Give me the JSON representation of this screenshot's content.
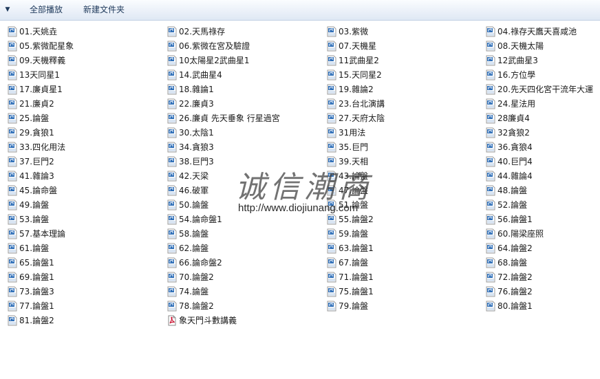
{
  "toolbar": {
    "menu_arrow": "▼",
    "play_all_label": "全部播放",
    "new_folder_label": "新建文件夹"
  },
  "watermark": {
    "text": "诚信潮商",
    "url": "http://www.diojiunang.com"
  },
  "files": [
    {
      "name": "01.天姚垚",
      "type": "mp3"
    },
    {
      "name": "02.天馬祿存",
      "type": "mp3"
    },
    {
      "name": "03.紫微",
      "type": "mp3"
    },
    {
      "name": "04.祿存天鷹天喜咸池",
      "type": "mp3"
    },
    {
      "name": "05.紫微配星象",
      "type": "mp3"
    },
    {
      "name": "06.紫微在宮及驗證",
      "type": "mp3"
    },
    {
      "name": "07.天機星",
      "type": "mp3"
    },
    {
      "name": "08.天機太陽",
      "type": "mp3"
    },
    {
      "name": "09.天機釋義",
      "type": "mp3"
    },
    {
      "name": "10太陽星2武曲星1",
      "type": "mp3"
    },
    {
      "name": "11武曲星2",
      "type": "mp3"
    },
    {
      "name": "12武曲星3",
      "type": "mp3"
    },
    {
      "name": "13天同星1",
      "type": "mp3"
    },
    {
      "name": "14.武曲星4",
      "type": "mp3"
    },
    {
      "name": "15.天同星2",
      "type": "mp3"
    },
    {
      "name": "16.方位學",
      "type": "mp3"
    },
    {
      "name": "17.廉貞星1",
      "type": "mp3"
    },
    {
      "name": "18.雜論1",
      "type": "mp3"
    },
    {
      "name": "19.雜論2",
      "type": "mp3"
    },
    {
      "name": "20.先天四化宮干流年大運",
      "type": "mp3"
    },
    {
      "name": "21.廉貞2",
      "type": "mp3"
    },
    {
      "name": "22.廉貞3",
      "type": "mp3"
    },
    {
      "name": "23.台北演講",
      "type": "mp3"
    },
    {
      "name": "24.星法用",
      "type": "mp3"
    },
    {
      "name": "25.論盤",
      "type": "mp3"
    },
    {
      "name": "26.廉貞 先天垂象 行星過宮",
      "type": "mp3"
    },
    {
      "name": "27.天府太陰",
      "type": "mp3"
    },
    {
      "name": "28廉貞4",
      "type": "mp3"
    },
    {
      "name": "29.貪狼1",
      "type": "mp3"
    },
    {
      "name": "30.太陰1",
      "type": "mp3"
    },
    {
      "name": "31用法",
      "type": "mp3"
    },
    {
      "name": "32貪狼2",
      "type": "mp3"
    },
    {
      "name": "33.四化用法",
      "type": "mp3"
    },
    {
      "name": "34.貪狼3",
      "type": "mp3"
    },
    {
      "name": "35.巨門",
      "type": "mp3"
    },
    {
      "name": "36.貪狼4",
      "type": "mp3"
    },
    {
      "name": "37.巨門2",
      "type": "mp3"
    },
    {
      "name": "38.巨門3",
      "type": "mp3"
    },
    {
      "name": "39.天相",
      "type": "mp3"
    },
    {
      "name": "40.巨門4",
      "type": "mp3"
    },
    {
      "name": "41.雜論3",
      "type": "mp3"
    },
    {
      "name": "42.天梁",
      "type": "mp3"
    },
    {
      "name": "43.論盤",
      "type": "mp3"
    },
    {
      "name": "44.雜論4",
      "type": "mp3"
    },
    {
      "name": "45.論命盤",
      "type": "mp3"
    },
    {
      "name": "46.破軍",
      "type": "mp3"
    },
    {
      "name": "47.論盤",
      "type": "mp3"
    },
    {
      "name": "48.論盤",
      "type": "mp3"
    },
    {
      "name": "49.論盤",
      "type": "mp3"
    },
    {
      "name": "50.論盤",
      "type": "mp3"
    },
    {
      "name": "51.論盤",
      "type": "mp3"
    },
    {
      "name": "52.論盤",
      "type": "mp3"
    },
    {
      "name": "53.論盤",
      "type": "mp3"
    },
    {
      "name": "54.論命盤1",
      "type": "mp3"
    },
    {
      "name": "55.論盤2",
      "type": "mp3"
    },
    {
      "name": "56.論盤1",
      "type": "mp3"
    },
    {
      "name": "57.基本理論",
      "type": "mp3"
    },
    {
      "name": "58.論盤",
      "type": "mp3"
    },
    {
      "name": "59.論盤",
      "type": "mp3"
    },
    {
      "name": "60.陽梁座照",
      "type": "mp3"
    },
    {
      "name": "61.論盤",
      "type": "mp3"
    },
    {
      "name": "62.論盤",
      "type": "mp3"
    },
    {
      "name": "63.論盤1",
      "type": "mp3"
    },
    {
      "name": "64.論盤2",
      "type": "mp3"
    },
    {
      "name": "65.論盤1",
      "type": "mp3"
    },
    {
      "name": "66.論命盤2",
      "type": "mp3"
    },
    {
      "name": "67.論盤",
      "type": "mp3"
    },
    {
      "name": "68.論盤",
      "type": "mp3"
    },
    {
      "name": "69.論盤1",
      "type": "mp3"
    },
    {
      "name": "70.論盤2",
      "type": "mp3"
    },
    {
      "name": "71.論盤1",
      "type": "mp3"
    },
    {
      "name": "72.論盤2",
      "type": "mp3"
    },
    {
      "name": "73.論盤3",
      "type": "mp3"
    },
    {
      "name": "74.論盤",
      "type": "mp3"
    },
    {
      "name": "75.論盤1",
      "type": "mp3"
    },
    {
      "name": "76.論盤2",
      "type": "mp3"
    },
    {
      "name": "77.論盤1",
      "type": "mp3"
    },
    {
      "name": "78.論盤2",
      "type": "mp3"
    },
    {
      "name": "79.論盤",
      "type": "mp3"
    },
    {
      "name": "80.論盤1",
      "type": "mp3"
    },
    {
      "name": "81.論盤2",
      "type": "mp3"
    },
    {
      "name": "象天門斗數講義",
      "type": "pdf"
    }
  ],
  "icons": {
    "mp3": "mp3-file-icon",
    "pdf": "pdf-file-icon"
  },
  "colors": {
    "toolbar_text": "#1e395b",
    "mp3_icon": "#2f6fb8",
    "pdf_icon": "#c8102e"
  }
}
